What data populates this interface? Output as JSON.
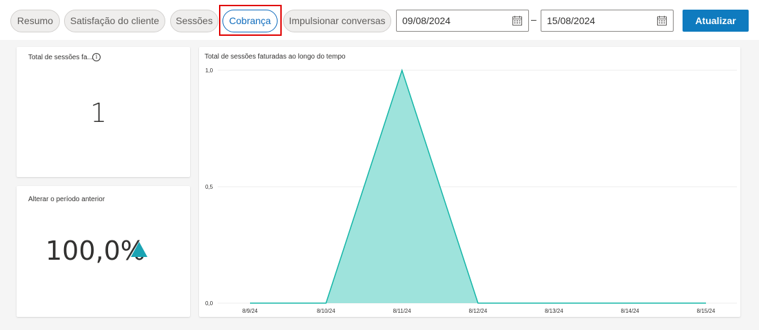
{
  "tabs": [
    {
      "label": "Resumo",
      "active": false
    },
    {
      "label": "Satisfação do cliente",
      "active": false
    },
    {
      "label": "Sessões",
      "active": false
    },
    {
      "label": "Cobrança",
      "active": true
    },
    {
      "label": "Impulsionar conversas",
      "active": false
    }
  ],
  "date_range": {
    "start": "09/08/2024",
    "separator": "–",
    "end": "15/08/2024",
    "icon": "calendar-icon"
  },
  "refresh_button": {
    "label": "Atualizar"
  },
  "kpi_total": {
    "title": "Total de sessões fa...",
    "info_icon": "info-icon",
    "info_glyph": "i",
    "value": "1"
  },
  "kpi_change": {
    "title": "Alterar o período anterior",
    "value": "100,0%",
    "trend_icon": "up-triangle-icon",
    "trend_color": "#1aa3b3"
  },
  "colors": {
    "accent": "#0f6cbd",
    "button": "#0f7bbf",
    "area_fill": "#9ee3dc",
    "area_stroke": "#12b5a6",
    "highlight": "#e00000"
  },
  "chart_data": {
    "type": "area",
    "title": "Total de sessões faturadas ao longo do tempo",
    "categories": [
      "8/9/24",
      "8/10/24",
      "8/11/24",
      "8/12/24",
      "8/13/24",
      "8/14/24",
      "8/15/24"
    ],
    "series": [
      {
        "values": [
          0,
          0,
          1,
          0,
          0,
          0,
          0
        ]
      }
    ],
    "y_ticks": [
      "0,0",
      "0,5",
      "1,0"
    ],
    "ylim": [
      0,
      1
    ],
    "grid": true
  }
}
